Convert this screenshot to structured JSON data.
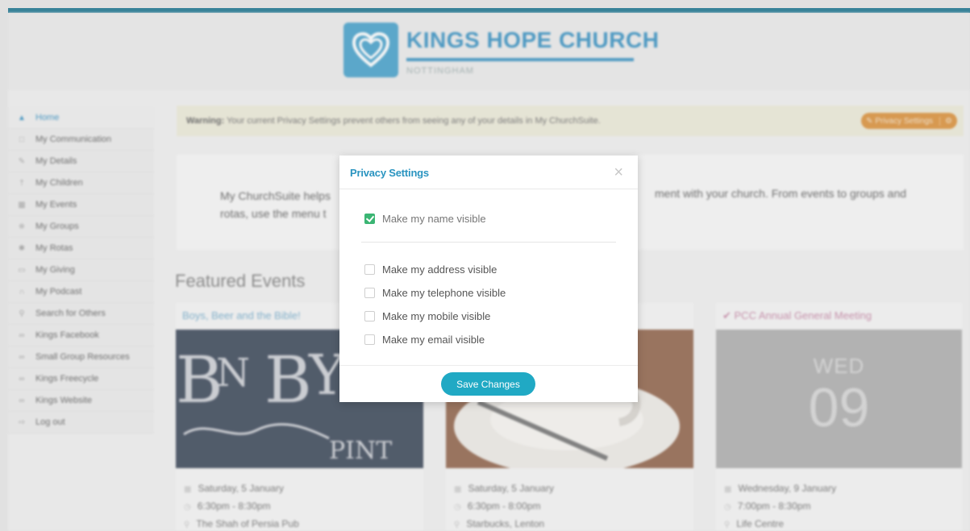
{
  "header": {
    "title": "KINGS HOPE CHURCH",
    "subtitle": "NOTTINGHAM",
    "logo_icon": "heart-icon"
  },
  "sidebar": {
    "items": [
      {
        "label": "Home",
        "icon": "home-icon",
        "active": true
      },
      {
        "label": "My Communication",
        "icon": "message-icon"
      },
      {
        "label": "My Details",
        "icon": "pencil-icon"
      },
      {
        "label": "My Children",
        "icon": "child-icon"
      },
      {
        "label": "My Events",
        "icon": "calendar-icon"
      },
      {
        "label": "My Groups",
        "icon": "group-icon"
      },
      {
        "label": "My Rotas",
        "icon": "rota-icon"
      },
      {
        "label": "My Giving",
        "icon": "wallet-icon"
      },
      {
        "label": "My Podcast",
        "icon": "headphones-icon"
      },
      {
        "label": "Search for Others",
        "icon": "search-people-icon"
      },
      {
        "label": "Kings Facebook",
        "icon": "link-icon"
      },
      {
        "label": "Small Group Resources",
        "icon": "link-icon"
      },
      {
        "label": "Kings Freecycle",
        "icon": "link-icon"
      },
      {
        "label": "Kings Website",
        "icon": "link-icon"
      },
      {
        "label": "Log out",
        "icon": "logout-icon"
      }
    ]
  },
  "warning": {
    "label": "Warning:",
    "text": " Your current Privacy Settings prevent others from seeing any of your details in My ChurchSuite.",
    "button_label": "Privacy Settings"
  },
  "welcome": {
    "line1_left": "My ChurchSuite helps",
    "line2_left": "rotas, use the menu t",
    "line1_right": "ment with your church. From events to groups and"
  },
  "featured": {
    "title": "Featured Events",
    "events": [
      {
        "title": "Boys, Beer and the Bible!",
        "date": "Saturday, 5 January",
        "time": "6:30pm - 8:30pm",
        "location": "The Shah of Persia Pub"
      },
      {
        "title": "",
        "date": "Saturday, 5 January",
        "time": "6:30pm - 8:00pm",
        "location": "Starbucks, Lenton"
      },
      {
        "title": "PCC Annual General Meeting",
        "date": "Wednesday, 9 January",
        "time": "7:00pm - 8:30pm",
        "location": "Life Centre",
        "day_label": "WED",
        "day_number": "09"
      }
    ]
  },
  "modal": {
    "title": "Privacy Settings",
    "close": "×",
    "options": [
      {
        "label": "Make my name visible",
        "checked": true
      },
      {
        "label": "Make my address visible",
        "checked": false
      },
      {
        "label": "Make my telephone visible",
        "checked": false
      },
      {
        "label": "Make my mobile visible",
        "checked": false
      },
      {
        "label": "Make my email visible",
        "checked": false
      }
    ],
    "save_label": "Save Changes"
  },
  "colors": {
    "accent": "#2a94c0",
    "save_button": "#20a9c4",
    "checkbox_checked": "#3bb573",
    "privacy_button": "#d98a2e"
  }
}
